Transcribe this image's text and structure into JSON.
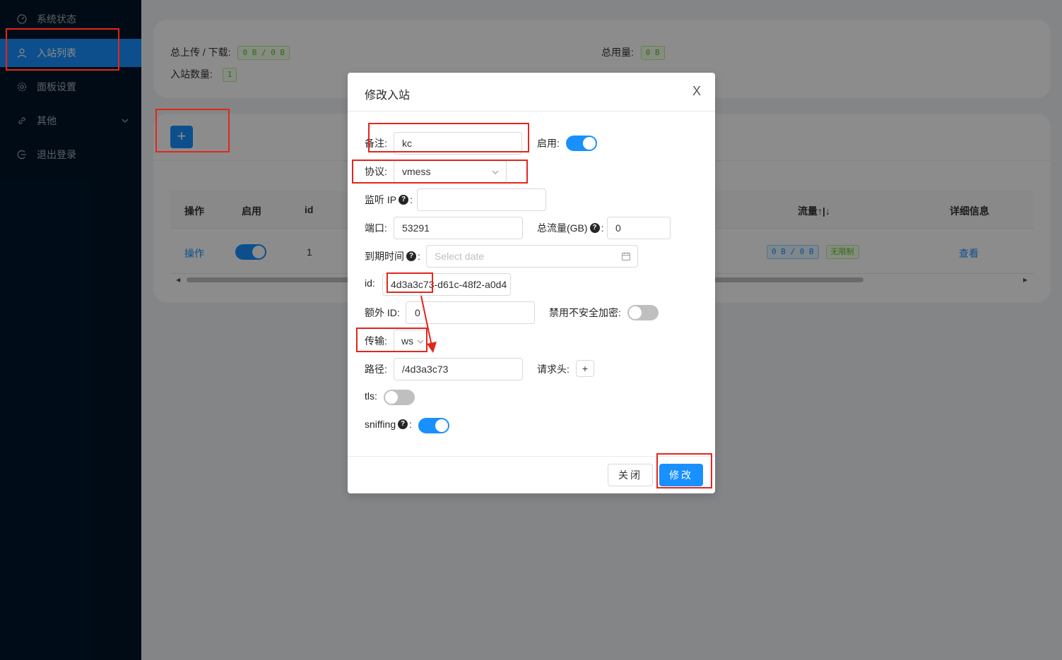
{
  "sidebar": {
    "items": [
      {
        "label": "系统状态",
        "icon": "dashboard-icon"
      },
      {
        "label": "入站列表",
        "icon": "user-icon",
        "active": true
      },
      {
        "label": "面板设置",
        "icon": "gear-icon"
      },
      {
        "label": "其他",
        "icon": "link-icon"
      },
      {
        "label": "退出登录",
        "icon": "logout-icon"
      }
    ]
  },
  "stats": {
    "upload_download_label": "总上传 / 下载:",
    "upload_download_value": "0 B / 0 B",
    "total_usage_label": "总用量:",
    "total_usage_value": "0 B",
    "inbound_count_label": "入站数量:",
    "inbound_count_value": "1"
  },
  "table": {
    "headers": [
      "操作",
      "启用",
      "id",
      "流量↑|↓",
      "详细信息"
    ],
    "row": {
      "action": "操作",
      "enabled": true,
      "id": "1",
      "traffic": "0 B / 0 B",
      "limit": "无限制",
      "detail": "查看"
    }
  },
  "modal": {
    "title": "修改入站",
    "close_label": "X",
    "fields": {
      "remark_label": "备注:",
      "remark_value": "kc",
      "enable_label": "启用:",
      "enable_value": true,
      "protocol_label": "协议:",
      "protocol_value": "vmess",
      "listen_ip_label": "监听 IP",
      "listen_ip_value": "",
      "port_label": "端口:",
      "port_value": "53291",
      "total_traffic_label": "总流量(GB)",
      "total_traffic_value": "0",
      "expiry_label": "到期时间",
      "expiry_placeholder": "Select date",
      "id_label": "id:",
      "id_value": "4d3a3c73-d61c-48f2-a0d4",
      "alter_id_label": "额外 ID:",
      "alter_id_value": "0",
      "disable_insecure_label": "禁用不安全加密:",
      "disable_insecure_value": false,
      "transport_label": "传输:",
      "transport_value": "ws",
      "path_label": "路径:",
      "path_value": "/4d3a3c73",
      "headers_label": "请求头:",
      "headers_add": "+",
      "tls_label": "tls:",
      "tls_value": false,
      "sniffing_label": "sniffing",
      "sniffing_value": true
    },
    "cancel_label": "关闭",
    "submit_label": "修改"
  },
  "colors": {
    "sidebar_bg": "#001529",
    "accent": "#1890ff",
    "annotation": "#e3261d"
  }
}
